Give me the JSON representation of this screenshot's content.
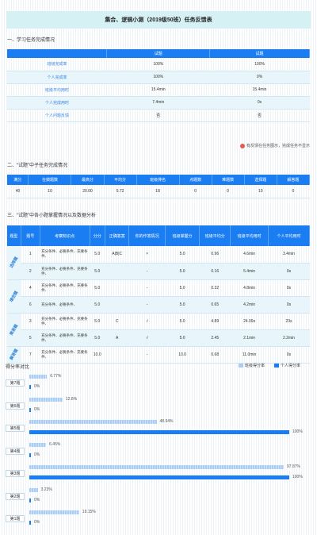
{
  "title": "集合、逻辑小测（2019级50班）任务反馈表",
  "section1": {
    "heading": "一、学习任务完成情况",
    "headers": [
      "",
      "试题",
      "试题"
    ],
    "rows": [
      [
        "班级完成率",
        "100%",
        "100%"
      ],
      [
        "个人完成率",
        "100%",
        "0%"
      ],
      [
        "班级平均用时",
        "15.4min",
        "15.4min"
      ],
      [
        "个人完成用时",
        "7.4min",
        "0s"
      ],
      [
        "个人问题反馈",
        "否",
        "否"
      ]
    ],
    "note": "有反馈在任务图示，完成任务不显示"
  },
  "section2": {
    "heading": "二、“试题”中子任务完成情况",
    "headers": [
      "满分",
      "在做题数",
      "最高分",
      "平均分",
      "班级排名",
      "点题数",
      "难题数",
      "选择题",
      "解答题"
    ],
    "row": [
      "40",
      "10",
      "20.00",
      "5.72",
      "18",
      "0",
      "0",
      "10",
      "0"
    ]
  },
  "section3": {
    "heading": "三、“试题”中各小题掌握情况以及数据分析",
    "headers": [
      "题型",
      "题号",
      "考察知识点",
      "分分",
      "正确答案",
      "你的作答情况",
      "班级掌握分",
      "班级平均分",
      "班级平均用时",
      "个人平均用时"
    ],
    "groups": [
      {
        "name": "选择题",
        "rows": [
          [
            "1",
            "充分条件、必要条件、充要条件、",
            "5.0",
            "A|B|C",
            "×",
            "5.0",
            "0.96",
            "4.6min",
            "3.4min"
          ],
          [
            "2",
            "充分条件、必要条件、充要条件、",
            "5.0",
            "",
            "-",
            "5.0",
            "0.16",
            "5.4min",
            "0s"
          ]
        ]
      },
      {
        "name": "填空题",
        "rows": [
          [
            "4",
            "充分条件、必要条件、充要条件、",
            "5.0",
            "",
            "-",
            "5.0",
            "0.32",
            "4.8min",
            "0s"
          ],
          [
            "6",
            "充分条件、必要条件、",
            "5.0",
            "",
            "-",
            "5.0",
            "0.65",
            "4.2min",
            "0s"
          ]
        ]
      },
      {
        "name": "简答题",
        "rows": [
          [
            "3",
            "充分条件、必要条件、充要条件、",
            "5.0",
            "C",
            "√",
            "5.0",
            "4.89",
            "24.09s",
            "23s"
          ],
          [
            "5",
            "充分条件、必要条件、充要条件、",
            "5.0",
            "A",
            "√",
            "5.0",
            "2.45",
            "2.1min",
            "2.2min"
          ]
        ]
      },
      {
        "name": "解答题",
        "rows": [
          [
            "7",
            "充分条件、必要条件、充要条件、",
            "10.0",
            "",
            "-",
            "10.0",
            "0.68",
            "11.0min",
            "0s"
          ]
        ]
      }
    ]
  },
  "bar_chart": {
    "title": "得分率对比",
    "legend_class": "班级得分率",
    "legend_personal": "个人得分率",
    "colors": {
      "class": "#aacdf5",
      "personal": "#1a7ef2"
    },
    "items": [
      {
        "label": "第7题",
        "class": 6.77,
        "class_label": "6.77%",
        "personal": 0,
        "personal_label": "0%"
      },
      {
        "label": "第6题",
        "class": 12.8,
        "class_label": "12.8%",
        "personal": 0,
        "personal_label": "0%"
      },
      {
        "label": "第5题",
        "class": 48.94,
        "class_label": "48.94%",
        "personal": 100,
        "personal_label": "100%"
      },
      {
        "label": "第4题",
        "class": 6.45,
        "class_label": "6.45%",
        "personal": 0,
        "personal_label": "0%"
      },
      {
        "label": "第3题",
        "class": 97.87,
        "class_label": "97.87%",
        "personal": 100,
        "personal_label": "100%"
      },
      {
        "label": "第2题",
        "class": 3.23,
        "class_label": "3.23%",
        "personal": 0,
        "personal_label": "0%"
      },
      {
        "label": "第1题",
        "class": 19.15,
        "class_label": "19.15%",
        "personal": 0,
        "personal_label": "0%"
      }
    ]
  }
}
